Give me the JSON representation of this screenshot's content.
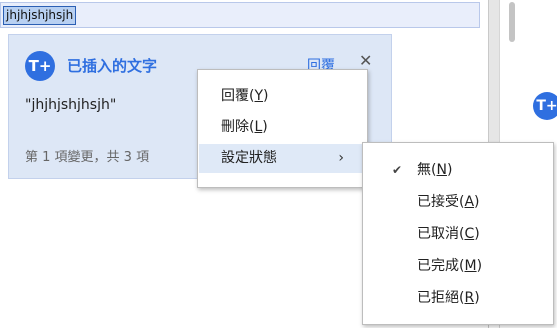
{
  "document": {
    "selected_text": "jhjhjshjhsjh"
  },
  "right_panel": {
    "avatar_text": "T+"
  },
  "comment_card": {
    "avatar_text": "T+",
    "title": "已插入的文字",
    "reply_label": "回覆",
    "close_glyph": "✕",
    "quote": "\"jhjhjshjhsjh\"",
    "footer": "第 1 項變更，共 3 項"
  },
  "context_menu": {
    "items": [
      {
        "label": "回覆",
        "mnemonic": "Y"
      },
      {
        "label": "刪除",
        "mnemonic": "L"
      },
      {
        "label": "設定狀態",
        "has_submenu": true
      }
    ],
    "chevron": "›"
  },
  "status_submenu": {
    "checked_index": 0,
    "check_glyph": "✔",
    "items": [
      {
        "label": "無",
        "mnemonic": "N"
      },
      {
        "label": "已接受",
        "mnemonic": "A"
      },
      {
        "label": "已取消",
        "mnemonic": "C"
      },
      {
        "label": "已完成",
        "mnemonic": "M"
      },
      {
        "label": "已拒絕",
        "mnemonic": "R"
      }
    ]
  },
  "colors": {
    "accent": "#2f6fe0",
    "card_bg": "#dde7f6",
    "selection_bg": "#b8d0f2"
  }
}
